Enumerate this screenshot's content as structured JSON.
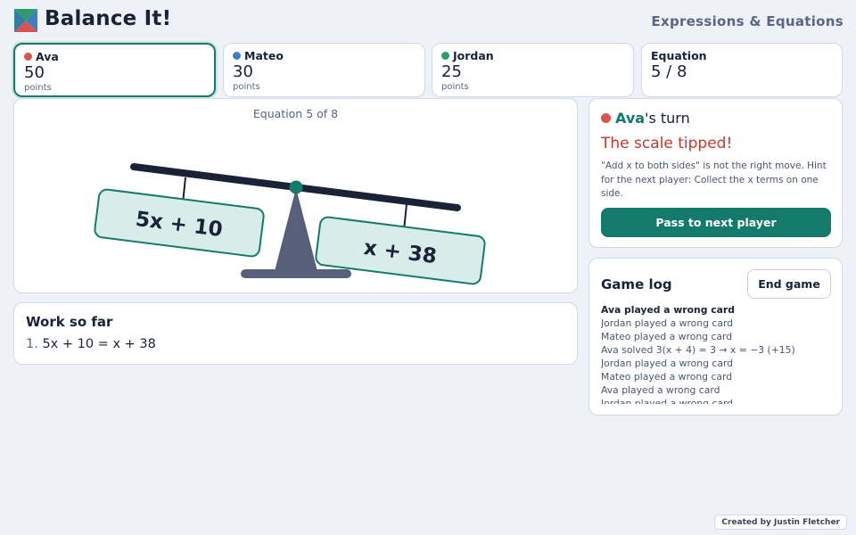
{
  "app": {
    "title": "Balance It!",
    "subtitle": "Expressions & Equations"
  },
  "players": [
    {
      "name": "Ava",
      "score": "50",
      "unit": "points",
      "color": "#d9534f",
      "active": true
    },
    {
      "name": "Mateo",
      "score": "30",
      "unit": "points",
      "color": "#3b7fc4",
      "active": false
    },
    {
      "name": "Jordan",
      "score": "25",
      "unit": "points",
      "color": "#2e9b6b",
      "active": false
    }
  ],
  "equation_status": {
    "label": "Equation",
    "value": "5 / 8"
  },
  "stage": {
    "counter": "Equation 5 of 8",
    "left_side": "5x + 10",
    "right_side": "x + 38"
  },
  "work": {
    "title": "Work so far",
    "steps": [
      {
        "num": "1.",
        "text": "5x + 10 = x + 38"
      }
    ]
  },
  "turn": {
    "player": "Ava",
    "suffix": "'s turn",
    "player_color": "#d9534f",
    "status": "The scale tipped!",
    "feedback": "\"Add x to both sides\" is not the right move. Hint for the next player: Collect the x terms on one side.",
    "pass_button": "Pass to next player"
  },
  "log": {
    "title": "Game log",
    "end_button": "End game",
    "entries": [
      "Ava played a wrong card",
      "Jordan played a wrong card",
      "Mateo played a wrong card",
      "Ava solved 3(x + 4) = 3 → x = −3 (+15)",
      "Jordan played a wrong card",
      "Mateo played a wrong card",
      "Ava played a wrong card",
      "Jordan played a wrong card"
    ]
  },
  "credit": "Created by Justin Fletcher",
  "colors": {
    "accent": "#137a6c",
    "error": "#c0392b",
    "beam": "#1a2238",
    "stand": "#56607a"
  }
}
